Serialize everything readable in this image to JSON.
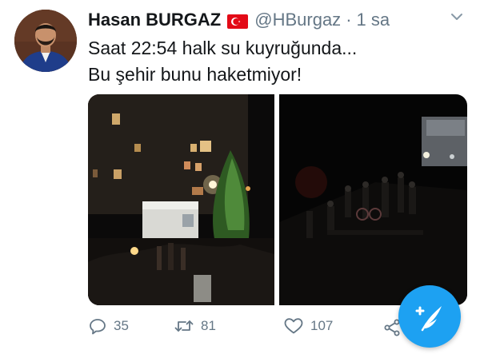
{
  "tweet": {
    "author": {
      "name": "Hasan BURGAZ",
      "handle": "@HBurgaz",
      "separator": "·",
      "time": "1 sa"
    },
    "text_lines": [
      "Saat 22:54 halk su kuyruğunda...",
      "Bu şehir bunu haketmiyor!"
    ],
    "media": {
      "count": 2,
      "items": [
        "night-street-building-truck",
        "night-street-crowd-water-truck"
      ]
    },
    "actions": {
      "reply_count": "35",
      "retweet_count": "81",
      "like_count": "107"
    },
    "icons": {
      "flag": "turkey-flag-icon",
      "menu": "chevron-down-icon",
      "reply": "reply-icon",
      "retweet": "retweet-icon",
      "like": "heart-icon",
      "share": "share-icon",
      "compose": "compose-tweet-icon"
    }
  },
  "colors": {
    "accent": "#1da1f2",
    "text": "#14171a",
    "muted": "#657786",
    "flag_red": "#e30a17"
  }
}
